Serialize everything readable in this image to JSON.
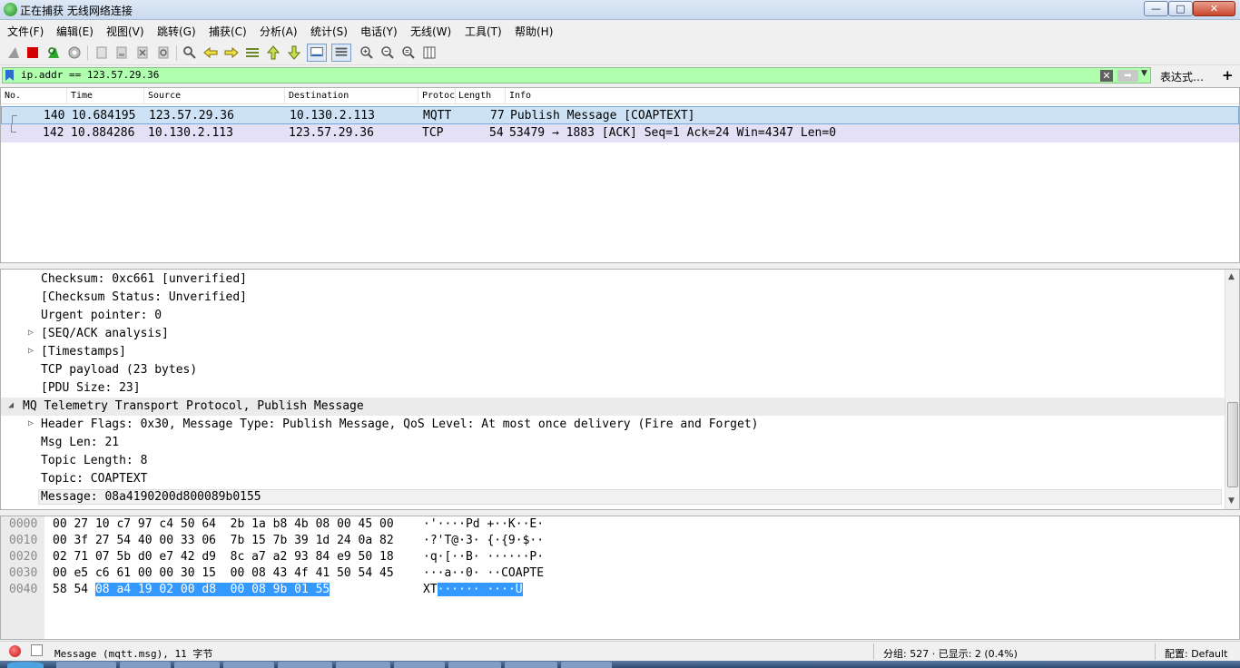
{
  "window": {
    "title": "正在捕获 无线网络连接",
    "min": "—",
    "max": "□",
    "close": "✕"
  },
  "menu": [
    "文件(F)",
    "编辑(E)",
    "视图(V)",
    "跳转(G)",
    "捕获(C)",
    "分析(A)",
    "统计(S)",
    "电话(Y)",
    "无线(W)",
    "工具(T)",
    "帮助(H)"
  ],
  "filter": {
    "value": "ip.addr == 123.57.29.36",
    "expression_label": "表达式…",
    "add": "+",
    "color": "#afffaf"
  },
  "packet_list": {
    "columns": [
      "No.",
      "Time",
      "Source",
      "Destination",
      "Protocol",
      "Length",
      "Info"
    ],
    "rows": [
      {
        "no": "140",
        "time": "10.684195",
        "source": "123.57.29.36",
        "destination": "10.130.2.113",
        "protocol": "MQTT",
        "length": "77",
        "info": "Publish Message [COAPTEXT]"
      },
      {
        "no": "142",
        "time": "10.884286",
        "source": "10.130.2.113",
        "destination": "123.57.29.36",
        "protocol": "TCP",
        "length": "54",
        "info": "53479 → 1883 [ACK] Seq=1 Ack=24 Win=4347 Len=0"
      }
    ]
  },
  "details": {
    "lines": [
      {
        "text": "Checksum: 0xc661 [unverified]",
        "expandable": false
      },
      {
        "text": "[Checksum Status: Unverified]",
        "expandable": false
      },
      {
        "text": "Urgent pointer: 0",
        "expandable": false
      },
      {
        "text": "[SEQ/ACK analysis]",
        "expandable": true
      },
      {
        "text": "[Timestamps]",
        "expandable": true
      },
      {
        "text": "TCP payload (23 bytes)",
        "expandable": false
      },
      {
        "text": "[PDU Size: 23]",
        "expandable": false
      },
      {
        "text": "MQ Telemetry Transport Protocol, Publish Message",
        "expandable": true,
        "expanded": true
      },
      {
        "text": "Header Flags: 0x30, Message Type: Publish Message, QoS Level: At most once delivery (Fire and Forget)",
        "expandable": true
      },
      {
        "text": "Msg Len: 21",
        "expandable": false
      },
      {
        "text": "Topic Length: 8",
        "expandable": false
      },
      {
        "text": "Topic: COAPTEXT",
        "expandable": false
      },
      {
        "text": "Message: 08a4190200d800089b0155",
        "expandable": false
      }
    ]
  },
  "bytes": [
    {
      "offset": "0000",
      "hex": "00 27 10 c7 97 c4 50 64  2b 1a b8 4b 08 00 45 00",
      "ascii": "·'····Pd +··K··E·"
    },
    {
      "offset": "0010",
      "hex": "00 3f 27 54 40 00 33 06  7b 15 7b 39 1d 24 0a 82",
      "ascii": "·?'T@·3· {·{9·$··"
    },
    {
      "offset": "0020",
      "hex": "02 71 07 5b d0 e7 42 d9  8c a7 a2 93 84 e9 50 18",
      "ascii": "·q·[··B· ······P·"
    },
    {
      "offset": "0030",
      "hex": "00 e5 c6 61 00 00 30 15  00 08 43 4f 41 50 54 45",
      "ascii": "···a··0· ··COAPTE"
    },
    {
      "offset": "0040",
      "hex_plain": "58 54 ",
      "hex_sel": "08 a4 19 02 00 d8  00 08 9b 01 55",
      "ascii_plain": "XT",
      "ascii_sel": "······ ····U"
    }
  ],
  "status": {
    "field": "Message (mqtt.msg), 11 字节",
    "packets": "分组: 527 · 已显示: 2 (0.4%)",
    "profile": "配置: Default"
  }
}
